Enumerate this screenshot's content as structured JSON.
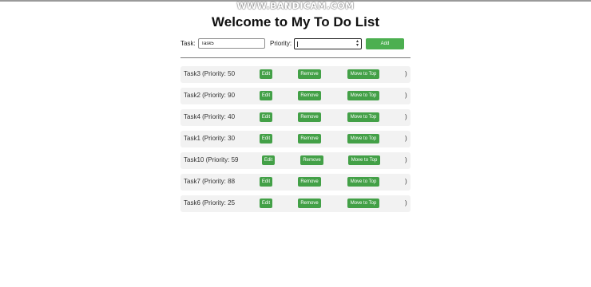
{
  "watermark": "WWW.BANDICAM.COM",
  "page": {
    "title": "Welcome to My To Do List"
  },
  "form": {
    "task_label": "Task:",
    "task_value": "Task5",
    "priority_label": "Priority:",
    "priority_value": "",
    "add_label": "Add"
  },
  "tasks": [
    {
      "text": "Task3 (Priority: 50",
      "edit": "Edit",
      "remove": "Remove",
      "move": "Move to Top",
      "end": ")"
    },
    {
      "text": "Task2 (Priority: 90",
      "edit": "Edit",
      "remove": "Remove",
      "move": "Move to Top",
      "end": ")"
    },
    {
      "text": "Task4 (Priority: 40",
      "edit": "Edit",
      "remove": "Remove",
      "move": "Move to Top",
      "end": ")"
    },
    {
      "text": "Task1 (Priority: 30",
      "edit": "Edit",
      "remove": "Remove",
      "move": "Move to Top",
      "end": ")"
    },
    {
      "text": "Task10 (Priority: 59",
      "edit": "Edit",
      "remove": "Remove",
      "move": "Move to Top",
      "end": ")"
    },
    {
      "text": "Task7 (Priority: 88",
      "edit": "Edit",
      "remove": "Remove",
      "move": "Move to Top",
      "end": ")"
    },
    {
      "text": "Task6 (Priority: 25",
      "edit": "Edit",
      "remove": "Remove",
      "move": "Move to Top",
      "end": ")"
    }
  ],
  "colors": {
    "button_green": "#43a047",
    "add_button_green": "#4caf50",
    "row_background": "#f2f2f2"
  },
  "icons": {
    "priority_spinner": "spinner-arrows-icon"
  }
}
